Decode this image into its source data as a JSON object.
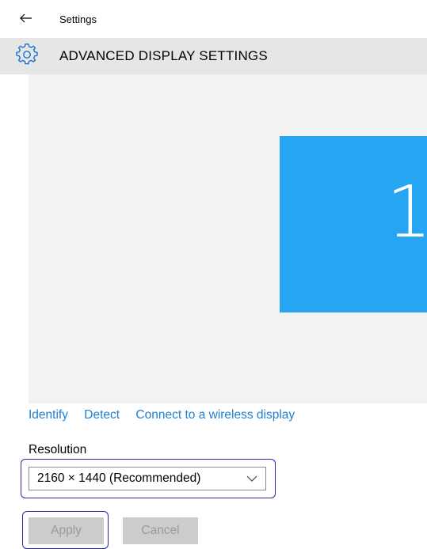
{
  "titlebar": {
    "back_icon": "arrow-left-icon",
    "title": "Settings"
  },
  "header": {
    "icon": "gear-icon",
    "title": "ADVANCED DISPLAY SETTINGS"
  },
  "display": {
    "monitor_number": "1",
    "monitor_color": "#26a5f2"
  },
  "links": {
    "identify": "Identify",
    "detect": "Detect",
    "wireless": "Connect to a wireless display",
    "color": "#1f7fd1"
  },
  "resolution": {
    "label": "Resolution",
    "selected": "2160 × 1440 (Recommended)"
  },
  "buttons": {
    "apply": "Apply",
    "cancel": "Cancel"
  }
}
